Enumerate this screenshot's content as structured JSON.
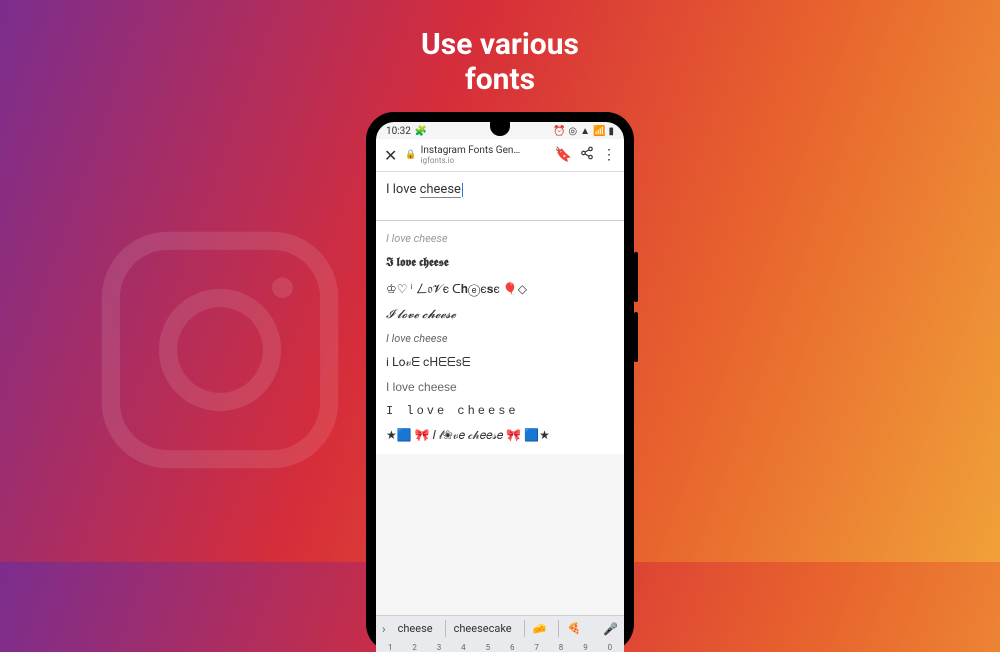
{
  "headline": {
    "line1": "Use various",
    "line2": "fonts"
  },
  "status": {
    "time": "10:32",
    "icons_left": "🧩",
    "icons_right": {
      "alarm": "⏰",
      "target": "◎",
      "wifi": "▲",
      "signal": "📶",
      "battery": "▮"
    }
  },
  "browser": {
    "title": "Instagram Fonts Gen…",
    "subtitle": "igfonts.io"
  },
  "input": {
    "prefix": "I love ",
    "underlined": "cheese"
  },
  "results": [
    {
      "text": "I love cheese",
      "cls": "r-faded"
    },
    {
      "text": "𝕴 𝖑𝖔𝖛𝖊 𝖈𝖍𝖊𝖊𝖘𝖊",
      "cls": "r-gothic"
    },
    {
      "text": "♔♡ ⁱ ㄥ𝔬𝓥є ᑕ𝐡ⓔє𝐬є  🎈◇",
      "cls": ""
    },
    {
      "text": "𝓘 𝓵𝓸𝓿𝓮 𝓬𝓱𝓮𝓮𝓼𝓮",
      "cls": "r-script"
    },
    {
      "text": "I love cheese",
      "cls": "r-italic"
    },
    {
      "text": "i ᒪo𝓋ᗴ cᕼᗴᗴsᗴ",
      "cls": ""
    },
    {
      "text": "I love cheese",
      "cls": "r-sans"
    },
    {
      "text": "I love cheese",
      "cls": "r-spaced"
    },
    {
      "text": "★🟦 🎀 𝐼 𝓁❀𝓋𝑒 𝒸𝒽𝑒𝑒𝓈𝑒 🎀 🟦★",
      "cls": ""
    }
  ],
  "suggestions": {
    "s1": "cheese",
    "s2": "cheesecake",
    "s3": "🧀",
    "s4": "🍕"
  },
  "keys": [
    "1",
    "2",
    "3",
    "4",
    "5",
    "6",
    "7",
    "8",
    "9",
    "0"
  ]
}
